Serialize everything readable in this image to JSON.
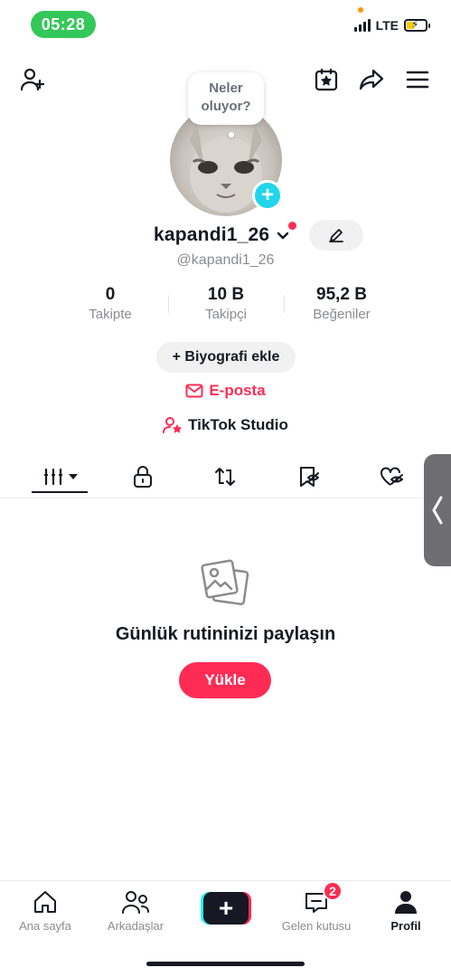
{
  "status_bar": {
    "time": "05:28",
    "network": "LTE",
    "battery_charging": true,
    "battery_level": 0.35
  },
  "profile": {
    "status_bubble": "Neler oluyor?",
    "username": "kapandi1_26",
    "handle": "@kapandi1_26"
  },
  "stats": [
    {
      "value": "0",
      "label": "Takipte"
    },
    {
      "value": "10 B",
      "label": "Takipçi"
    },
    {
      "value": "95,2 B",
      "label": "Beğeniler"
    }
  ],
  "actions": {
    "bio_button": "+ Biyografi ekle",
    "email_link": "E-posta",
    "studio_link": "TikTok Studio"
  },
  "tabs": [
    {
      "icon": "grid-icon",
      "active": true
    },
    {
      "icon": "lock-icon",
      "active": false
    },
    {
      "icon": "repost-icon",
      "active": false
    },
    {
      "icon": "bookmark-hidden-icon",
      "active": false
    },
    {
      "icon": "heart-hidden-icon",
      "active": false
    }
  ],
  "empty_state": {
    "title": "Günlük rutininizi paylaşın",
    "button": "Yükle"
  },
  "bottom_nav": [
    {
      "label": "Ana sayfa",
      "icon": "home-icon"
    },
    {
      "label": "Arkadaşlar",
      "icon": "friends-icon"
    },
    {
      "label": "",
      "icon": "create-icon"
    },
    {
      "label": "Gelen kutusu",
      "icon": "inbox-icon",
      "badge": "2"
    },
    {
      "label": "Profil",
      "icon": "profile-icon",
      "active": true
    }
  ],
  "colors": {
    "accent": "#fe2c55",
    "cyan": "#25f4ee",
    "text": "#161823",
    "muted": "#8a8b91"
  }
}
